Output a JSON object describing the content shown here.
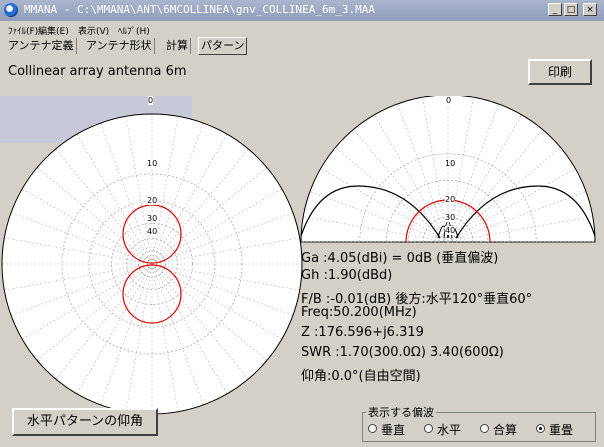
{
  "window": {
    "title": "MMANA - C:\\MMANA\\ANT\\6MCOLLINEA\\gnv_COLLINEA_6m_3.MAA",
    "controls": [
      "_",
      "□",
      "×"
    ]
  },
  "menu": [
    "ﾌｧｲﾙ(F)",
    "編集(E)",
    "表示(V)",
    "ﾍﾙﾌﾟ(H)"
  ],
  "tabs": [
    {
      "label": "アンテナ定義",
      "active": false
    },
    {
      "label": "アンテナ形状",
      "active": false
    },
    {
      "label": "計算",
      "active": false
    },
    {
      "label": "パターン",
      "active": true
    }
  ],
  "pattern_title": "Collinear array antenna 6m",
  "print_button": "印刷",
  "horizontal_pattern": {
    "ring_labels": [
      "0",
      "10",
      "20",
      "30",
      "40"
    ]
  },
  "vertical_pattern": {
    "ring_labels": [
      "0",
      "10",
      "20",
      "30",
      "40"
    ]
  },
  "results": {
    "ga": "Ga :4.05(dBi) = 0dB (垂直偏波)",
    "gh": "Gh :1.90(dBd)",
    "fb": "F/B :-0.01(dB) 後方:水平120°垂直60°",
    "freq": "Freq:50.200(MHz)",
    "z": "Z  :176.596+j6.319",
    "swr": "SWR :1.70(300.0Ω) 3.40(600Ω)",
    "elev": "仰角:0.0°(自由空間)"
  },
  "elevation_button": "水平パターンの仰角",
  "polarization": {
    "label": "表示する偏波",
    "options": [
      {
        "label": "垂直",
        "selected": false
      },
      {
        "label": "水平",
        "selected": false
      },
      {
        "label": "合算",
        "selected": false
      },
      {
        "label": "重畳",
        "selected": true
      }
    ]
  },
  "colors": {
    "pattern_red": "#e00000",
    "pattern_black": "#000000",
    "grid": "#a0a0a0",
    "titlebar": "#97a4c0"
  }
}
